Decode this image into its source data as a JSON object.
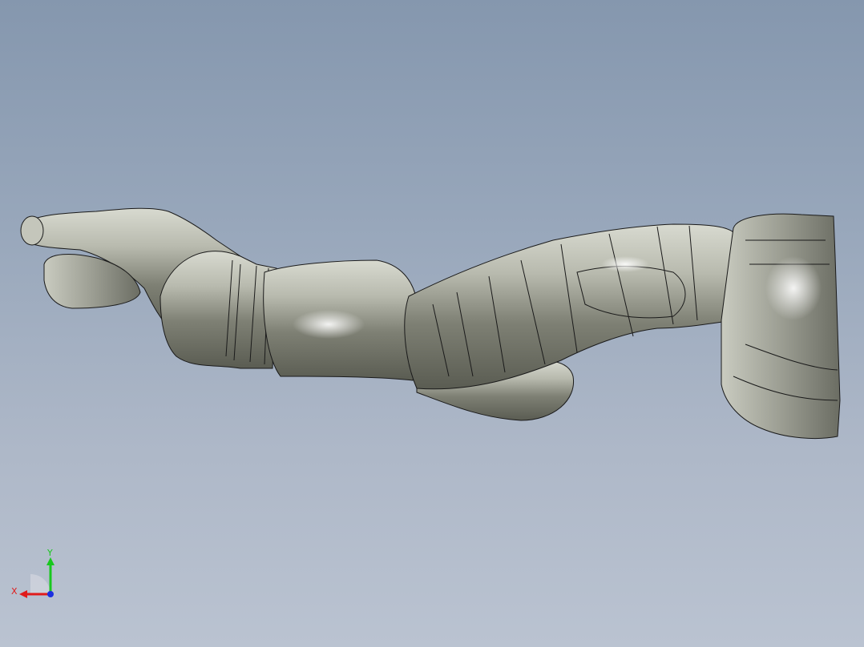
{
  "viewport": {
    "background_top": "#8597ae",
    "background_bottom": "#bac3d1",
    "model": {
      "description_icon": "robotic-arm-model",
      "surface_color": "#a9ab9e",
      "edge_color": "#1a1a1a"
    }
  },
  "triad": {
    "x_label": "X",
    "y_label": "Y",
    "x_color": "#e01b1b",
    "y_color": "#18c81e",
    "z_color": "#1b2fe0"
  }
}
